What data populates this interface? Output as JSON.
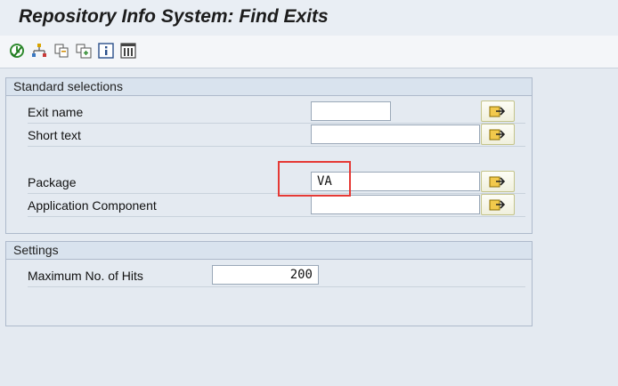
{
  "window": {
    "title": "Repository Info System: Find Exits"
  },
  "toolbar": {
    "icons": [
      "execute-icon",
      "hierarchy-icon",
      "copy-icon",
      "expand-icon",
      "info-icon",
      "columns-icon"
    ]
  },
  "standard_selections": {
    "header": "Standard selections",
    "fields": [
      {
        "label": "Exit name",
        "value": ""
      },
      {
        "label": "Short text",
        "value": ""
      },
      {
        "label": "Package",
        "value": "VA"
      },
      {
        "label": "Application Component",
        "value": ""
      }
    ]
  },
  "settings": {
    "header": "Settings",
    "max_hits_label": "Maximum No. of Hits",
    "max_hits_value": "200"
  },
  "colors": {
    "background": "#e4eaf1",
    "group_header": "#d9e3ee",
    "highlight": "#e53935"
  }
}
